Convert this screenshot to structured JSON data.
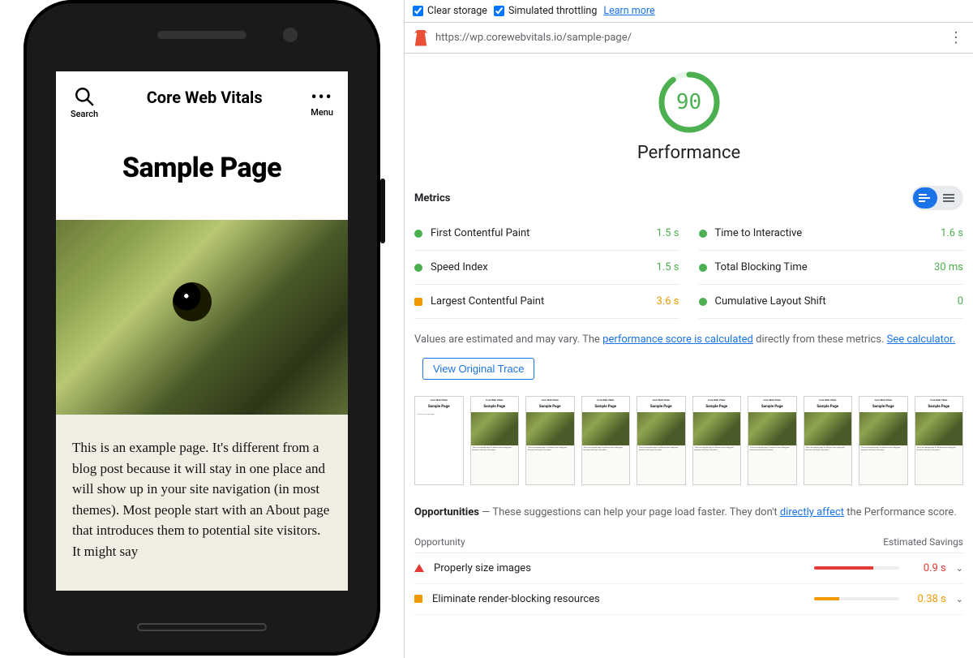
{
  "toolbar": {
    "clear_storage": "Clear storage",
    "simulated_throttling": "Simulated throttling",
    "learn_more": "Learn more"
  },
  "url": "https://wp.corewebvitals.io/sample-page/",
  "gauge": {
    "score": "90",
    "label": "Performance"
  },
  "metrics_header": "Metrics",
  "metrics": [
    {
      "name": "First Contentful Paint",
      "value": "1.5 s",
      "status": "green"
    },
    {
      "name": "Time to Interactive",
      "value": "1.6 s",
      "status": "green"
    },
    {
      "name": "Speed Index",
      "value": "1.5 s",
      "status": "green"
    },
    {
      "name": "Total Blocking Time",
      "value": "30 ms",
      "status": "green"
    },
    {
      "name": "Largest Contentful Paint",
      "value": "3.6 s",
      "status": "orange"
    },
    {
      "name": "Cumulative Layout Shift",
      "value": "0",
      "status": "green"
    }
  ],
  "disclaimer": {
    "pre": "Values are estimated and may vary. The ",
    "link1": "performance score is calculated",
    "mid": " directly from these metrics. ",
    "link2": "See calculator."
  },
  "view_trace": "View Original Trace",
  "opportunities": {
    "heading": "Opportunities",
    "sep": " — ",
    "lead": "These suggestions can help your page load faster. They don't ",
    "link": "directly affect",
    "tail": " the Performance score.",
    "col_opportunity": "Opportunity",
    "col_savings": "Estimated Savings",
    "items": [
      {
        "shape": "tri",
        "color": "red",
        "name": "Properly size images",
        "savings": "0.9 s",
        "bar": 70
      },
      {
        "shape": "sq",
        "color": "orange",
        "name": "Eliminate render-blocking resources",
        "savings": "0.38 s",
        "bar": 30
      }
    ]
  },
  "screen": {
    "site_title": "Core Web Vitals",
    "search_label": "Search",
    "menu_label": "Menu",
    "page_title": "Sample Page",
    "body": "This is an example page. It's different from a blog post because it will stay in one place and will show up in your site navigation (in most themes). Most people start with an About page that introduces them to potential site visitors. It might say"
  },
  "filmstrip_count": 10
}
